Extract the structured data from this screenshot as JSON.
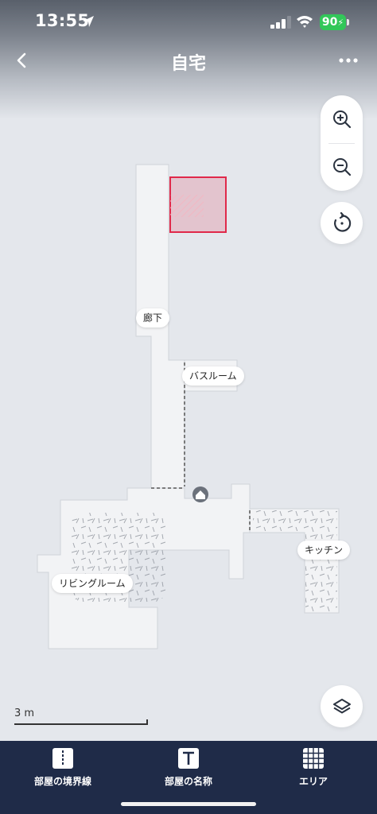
{
  "status_bar": {
    "time": "13:55",
    "battery": "90",
    "icons": [
      "location-arrow-icon",
      "cellular-signal-icon",
      "wifi-icon",
      "battery-charging-icon"
    ]
  },
  "navbar": {
    "title": "自宅",
    "back_icon": "chevron-left-icon",
    "more_icon": "ellipsis-icon"
  },
  "map_controls": {
    "zoom_in_icon": "zoom-in-icon",
    "zoom_out_icon": "zoom-out-icon",
    "rotate_icon": "rotate-icon",
    "layers_icon": "layers-icon"
  },
  "rooms": {
    "hallway": "廊下",
    "bathroom": "バスルーム",
    "kitchen": "キッチン",
    "living": "リビングルーム"
  },
  "map_markers": {
    "dock_icon": "home-icon",
    "selection_color": "#e0294a"
  },
  "scale": {
    "label": "3 m"
  },
  "bottom_tabs": [
    {
      "label": "部屋の境界線",
      "icon": "divider-icon"
    },
    {
      "label": "部屋の名称",
      "icon": "text-icon"
    },
    {
      "label": "エリア",
      "icon": "grid-icon"
    }
  ],
  "colors": {
    "bottom_bar": "#1f2b48",
    "map_background": "#e4e7ec",
    "floor": "#f2f3f5",
    "battery": "#32c759"
  }
}
